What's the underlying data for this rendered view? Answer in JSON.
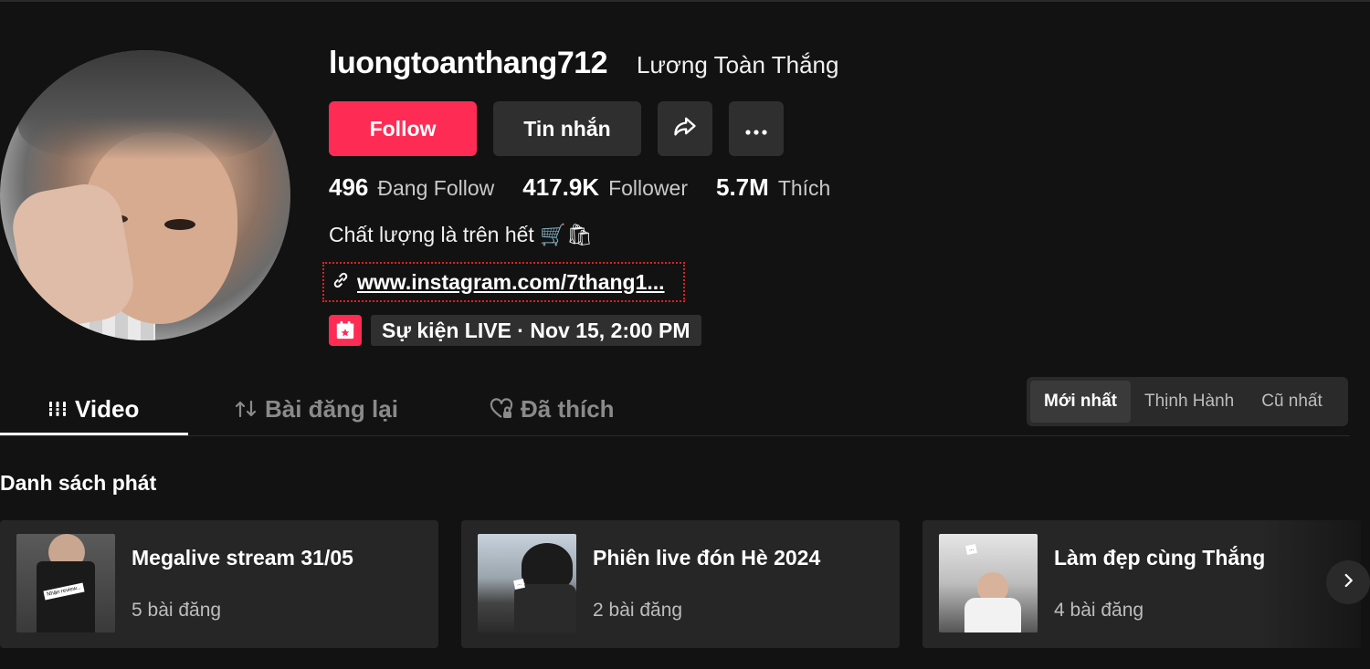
{
  "profile": {
    "username": "luongtoanthang712",
    "nickname": "Lương Toàn Thắng",
    "bio": "Chất lượng là trên hết 🛒🛍",
    "link": "www.instagram.com/7thang1...",
    "event": "Sự kiện LIVE · Nov 15, 2:00 PM"
  },
  "actions": {
    "follow_label": "Follow",
    "message_label": "Tin nhắn"
  },
  "stats": {
    "following_count": "496",
    "following_label": "Đang Follow",
    "followers_count": "417.9K",
    "followers_label": "Follower",
    "likes_count": "5.7M",
    "likes_label": "Thích"
  },
  "tabs": [
    {
      "label": "Video",
      "active": true
    },
    {
      "label": "Bài đăng lại",
      "active": false
    },
    {
      "label": "Đã thích",
      "active": false
    }
  ],
  "sort": {
    "options": [
      "Mới nhất",
      "Thịnh Hành",
      "Cũ nhất"
    ],
    "selected": "Mới nhất"
  },
  "playlists": {
    "title": "Danh sách phát",
    "items": [
      {
        "title": "Megalive stream 31/05",
        "count": "5 bài đăng"
      },
      {
        "title": "Phiên live đón Hè 2024",
        "count": "2 bài đăng"
      },
      {
        "title": "Làm đẹp cùng Thắng",
        "count": "4 bài đăng"
      }
    ]
  },
  "colors": {
    "background": "#121212",
    "accent": "#fe2c55",
    "button_secondary": "#2f2f2f"
  }
}
